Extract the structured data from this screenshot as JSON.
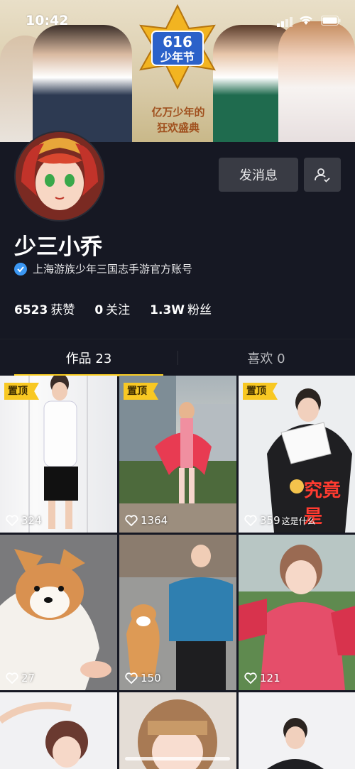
{
  "status_bar": {
    "time": "10:42"
  },
  "banner": {
    "logo_text": "616 少年节",
    "tagline_line1": "亿万少年的",
    "tagline_line2": "狂欢盛典"
  },
  "profile": {
    "name": "少三小乔",
    "verification": "上海游族少年三国志手游官方账号",
    "message_button": "发消息",
    "stats": [
      {
        "num": "6523",
        "label": "获赞"
      },
      {
        "num": "0",
        "label": "关注"
      },
      {
        "num": "1.3W",
        "label": "粉丝"
      }
    ]
  },
  "tabs": [
    {
      "label": "作品 23"
    },
    {
      "label": "喜欢 0"
    }
  ],
  "videos": [
    {
      "pinned": true,
      "pin_label": "置顶",
      "likes": "324"
    },
    {
      "pinned": true,
      "pin_label": "置顶",
      "likes": "1364"
    },
    {
      "pinned": true,
      "pin_label": "置顶",
      "likes": "359",
      "caption": "这是什么",
      "overlay": "究竟是"
    },
    {
      "pinned": false,
      "likes": "27"
    },
    {
      "pinned": false,
      "likes": "150"
    },
    {
      "pinned": false,
      "likes": "121"
    },
    {
      "pinned": false
    },
    {
      "pinned": false
    },
    {
      "pinned": false
    }
  ],
  "colors": {
    "background": "#161823",
    "pin": "#f8c823",
    "verify": "#3b97f3",
    "tab_underline": "#facd22"
  }
}
